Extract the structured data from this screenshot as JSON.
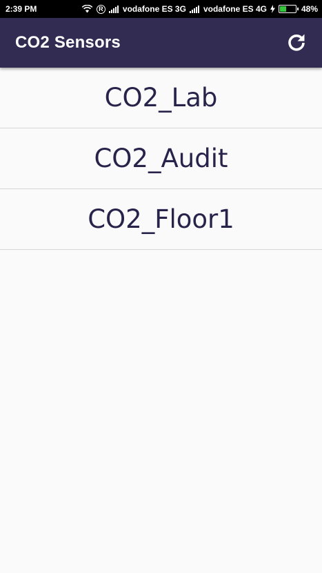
{
  "status_bar": {
    "time": "2:39 PM",
    "carrier1": "vodafone ES 3G",
    "carrier2": "vodafone ES 4G",
    "battery": "48%",
    "battery_level": 0.48,
    "battery_color": "#35c83a",
    "icons": [
      "wifi-icon",
      "roaming-icon",
      "signal-icon",
      "signal-icon",
      "charging-icon",
      "battery-icon"
    ]
  },
  "app_bar": {
    "title": "CO2 Sensors",
    "background": "#332c52",
    "refresh_icon": "refresh-icon"
  },
  "sensors": [
    {
      "label": "CO2_Lab"
    },
    {
      "label": "CO2_Audit"
    },
    {
      "label": "CO2_Floor1"
    }
  ]
}
